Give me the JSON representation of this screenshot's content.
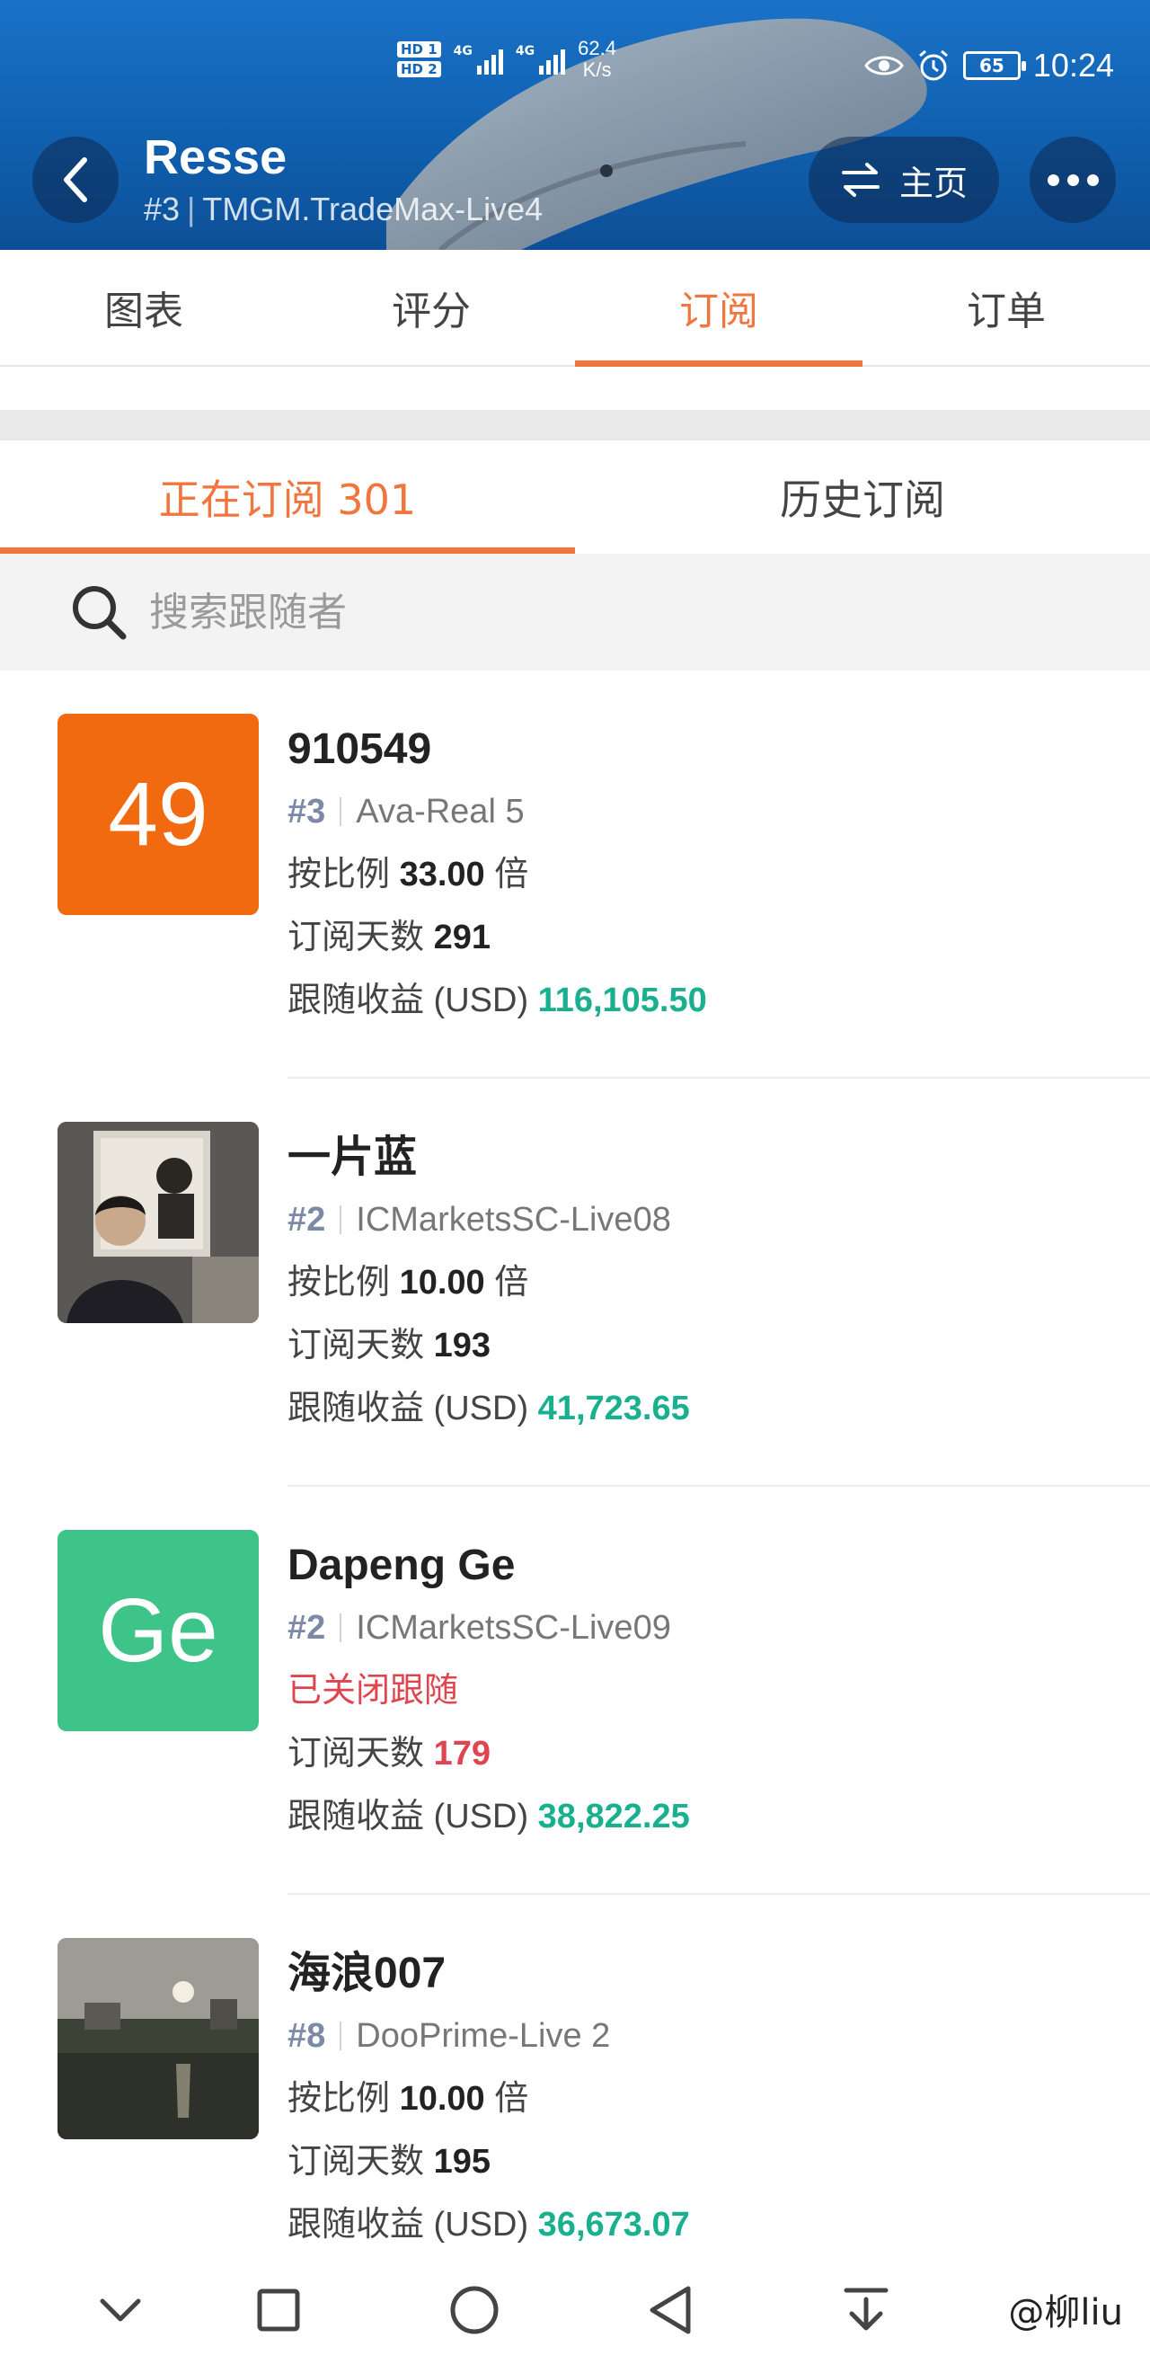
{
  "status_bar": {
    "hd1": "HD 1",
    "hd2": "HD 2",
    "signal1": "4G",
    "signal2": "4G",
    "net_speed_value": "62.4",
    "net_speed_unit": "K/s",
    "battery": "65",
    "time": "10:24"
  },
  "header": {
    "title": "Resse",
    "rank": "#3",
    "server": "TMGM.TradeMax-Live4",
    "home_label": "主页"
  },
  "main_tabs": [
    {
      "label": "图表"
    },
    {
      "label": "评分"
    },
    {
      "label": "订阅",
      "active": true
    },
    {
      "label": "订单"
    }
  ],
  "sub_tabs": {
    "current": "正在订阅 301",
    "history": "历史订阅"
  },
  "search": {
    "placeholder": "搜索跟随者"
  },
  "labels": {
    "ratio": "按比例",
    "times": "倍",
    "days": "订阅天数",
    "profit": "跟随收益 (USD)",
    "closed": "已关闭跟随"
  },
  "subscribers": [
    {
      "name": "910549",
      "avatar_text": "49",
      "avatar_color": "#f26a0f",
      "rank": "#3",
      "server": "Ava-Real 5",
      "ratio": "33.00",
      "days": "291",
      "profit": "116,105.50"
    },
    {
      "name": "一片蓝",
      "avatar_text": "",
      "avatar_image": "person-in-suit-photo",
      "rank": "#2",
      "server": "ICMarketsSC-Live08",
      "ratio": "10.00",
      "days": "193",
      "profit": "41,723.65"
    },
    {
      "name": "Dapeng Ge",
      "avatar_text": "Ge",
      "avatar_color": "#3ec488",
      "rank": "#2",
      "server": "ICMarketsSC-Live09",
      "status": "已关闭跟随",
      "days": "179",
      "profit": "38,822.25"
    },
    {
      "name": "海浪007",
      "avatar_text": "",
      "avatar_image": "sunset-river-photo",
      "rank": "#8",
      "server": "DooPrime-Live 2",
      "ratio": "10.00",
      "days": "195",
      "profit": "36,673.07"
    }
  ],
  "watermark": "@柳liu",
  "colors": {
    "accent": "#f0763e",
    "profit_green": "#19b08f",
    "closed_red": "#e0454f",
    "header_blue": "#1266b8"
  }
}
